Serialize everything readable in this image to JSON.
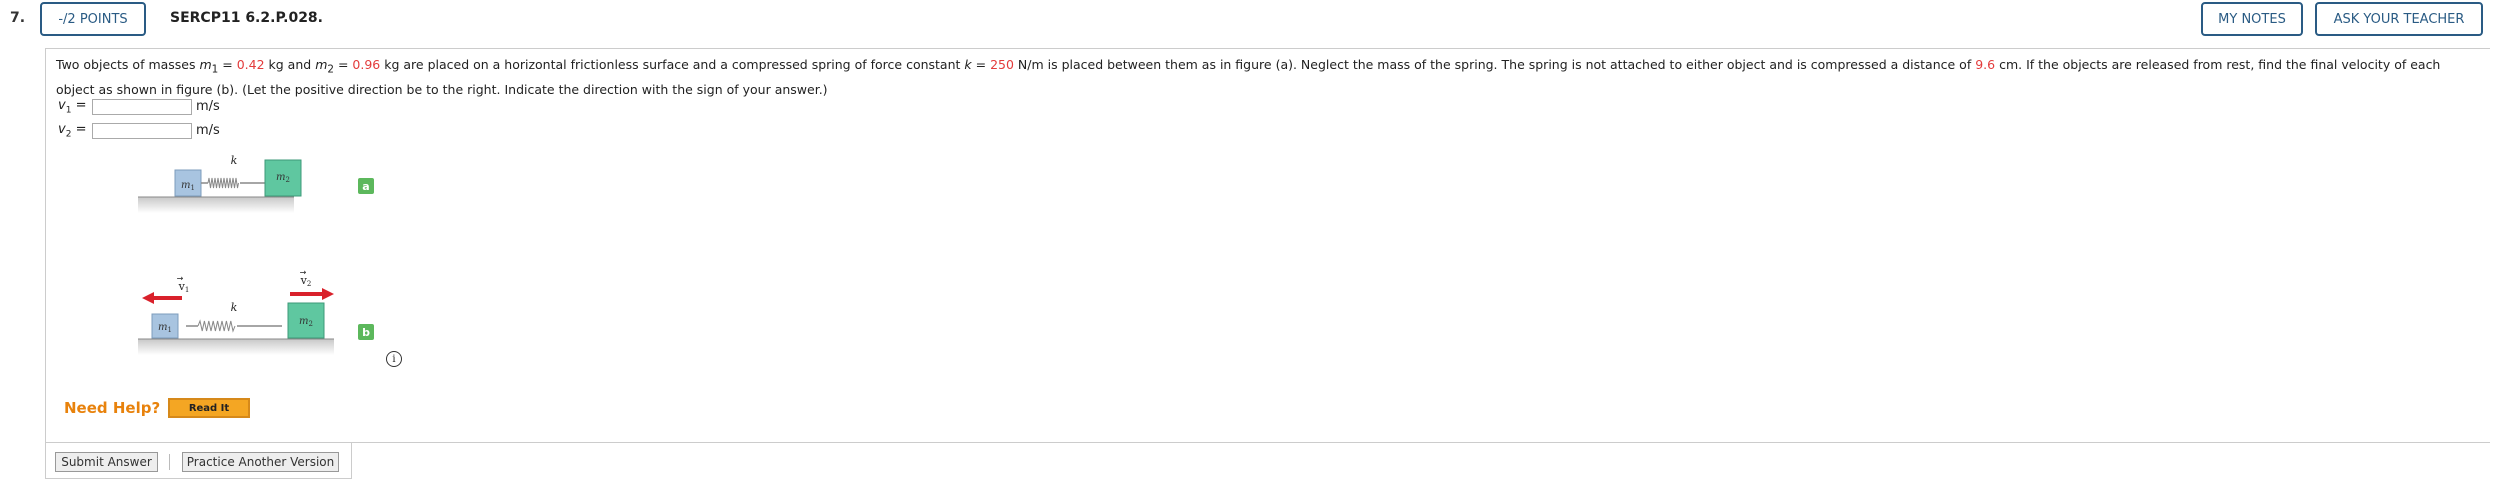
{
  "header": {
    "question_number": "7.",
    "points_label": "-/2 POINTS",
    "question_id": "SERCP11 6.2.P.028.",
    "my_notes_label": "MY NOTES",
    "ask_teacher_label": "ASK YOUR TEACHER"
  },
  "question": {
    "t1": "Two objects of masses ",
    "m1_sym": "m",
    "m1_sub": "1",
    "t2": " = ",
    "m1_val": "0.42",
    "t3": " kg and ",
    "m2_sym": "m",
    "m2_sub": "2",
    "t4": " = ",
    "m2_val": "0.96",
    "t5": " kg are placed on a horizontal frictionless surface and a compressed spring of force constant ",
    "k_sym": "k",
    "t6": " = ",
    "k_val": "250",
    "t7": " N/m is placed between them as in figure (a). Neglect the mass of the spring. The spring is not attached to either object and is compressed a distance of ",
    "d_val": "9.6",
    "t8": " cm. If the objects are released from rest, find the final velocity of each object as shown in figure (b). (Let the positive direction be to the right. Indicate the direction with the sign of your answer.)"
  },
  "answers": [
    {
      "var": "v",
      "sub": "1",
      "eq": " =",
      "value": "",
      "unit": "m/s"
    },
    {
      "var": "v",
      "sub": "2",
      "eq": " =",
      "value": "",
      "unit": "m/s"
    }
  ],
  "figure": {
    "k_label": "k",
    "m1_label": "m",
    "m1_sub": "1",
    "m2_label": "m",
    "m2_sub": "2",
    "v1_label": "v",
    "v1_sub": "1",
    "v2_label": "v",
    "v2_sub": "2",
    "badge_a": "a",
    "badge_b": "b",
    "info_glyph": "i"
  },
  "help": {
    "need_help": "Need Help?",
    "read_it": "Read It"
  },
  "footer": {
    "submit_label": "Submit Answer",
    "practice_label": "Practice Another Version"
  },
  "colors": {
    "accent": "#2a5b84",
    "given_value": "#e33b3b",
    "block_m1": "#a8c4e0",
    "block_m2": "#5fc7a0",
    "arrow": "#d9212b",
    "badge": "#5cb85c",
    "need_help": "#e8820c"
  }
}
